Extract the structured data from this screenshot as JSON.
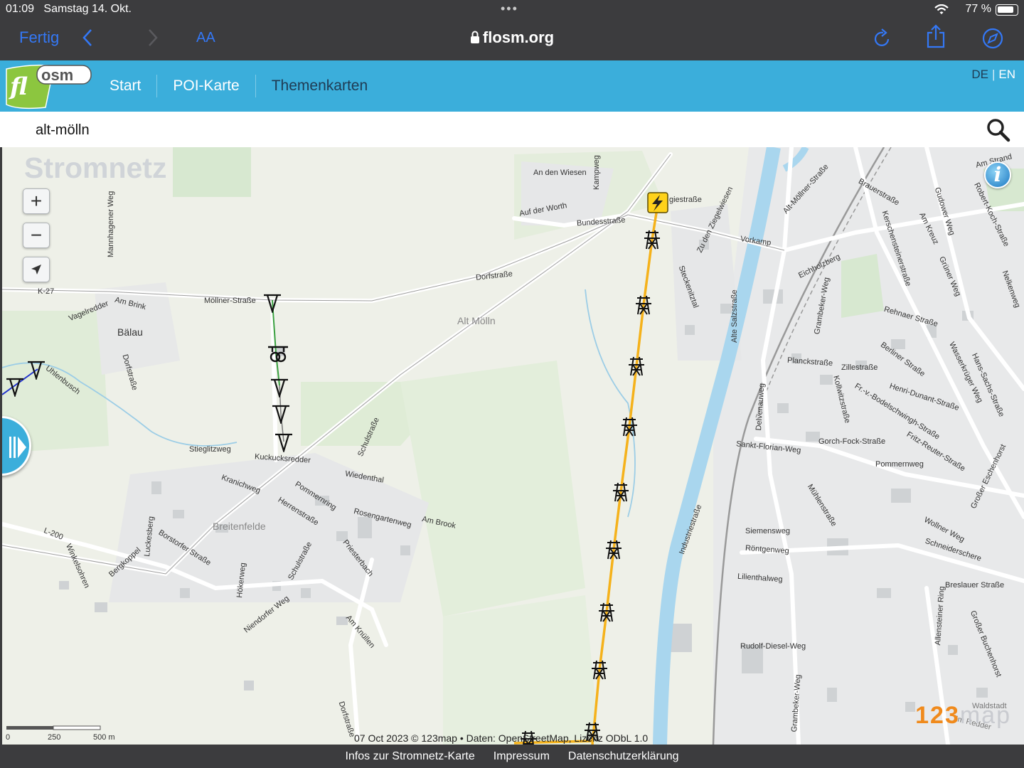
{
  "status_bar": {
    "time": "01:09",
    "date": "Samstag 14. Okt.",
    "battery": "77 %"
  },
  "browser": {
    "done_label": "Fertig",
    "text_size_label": "AA",
    "domain": "flosm.org"
  },
  "site": {
    "logo_text": {
      "part1": "fl",
      "part2": "osm"
    },
    "nav": [
      "Start",
      "POI-Karte",
      "Themenkarten"
    ],
    "lang": {
      "de": "DE",
      "en": "EN"
    }
  },
  "search": {
    "value": "alt-mölln"
  },
  "map": {
    "title": "Stromnetz",
    "controls": {
      "zoom_in": "+",
      "zoom_out": "−"
    },
    "labels": {
      "an_den_wiesen": "An den Wiesen",
      "kampweg": "Kampweg",
      "auf_der_worth": "Auf der Worth",
      "bundesstrasse": "Bundesstraße",
      "giestrasse": "giestraße",
      "zu_den_ziegelwiesen": "Zu den Ziegelwiesen",
      "vorkamp": "Vorkamp",
      "alt_moellner_strasse": "Alt-Möllner-Straße",
      "brauerstrasse": "Brauerstraße",
      "gudower_weg": "Gudower Weg",
      "robert_koch": "Robert-Koch-Straße",
      "am_kreuz": "Am Kreuz",
      "kerschensteiner": "Kerschensteinerstraße",
      "eichholzberg": "Eichholzberg",
      "gruener_weg": "Grüner Weg",
      "nelkenweg": "Nelkenweg",
      "mannhagener_weg": "Mannhagener Weg",
      "dorfstrasse_n": "Dorfstraße",
      "k27": "K-27",
      "moellner_strasse": "Möllner-Straße",
      "am_brink": "Am Brink",
      "vagelredder": "Vagelredder",
      "baelau": "Bälau",
      "dorfstrasse_w": "Dorfstraße",
      "uhlenbusch": "Uhlenbusch",
      "alt_moelln": "Alt Mölln",
      "steckenitztal": "Steckenitztal",
      "alte_salzstrasse": "Alte Salzstraße",
      "grambeker_weg": "Grambeker-Weg",
      "rehnaer_strasse": "Rehnaer Straße",
      "berliner_strasse": "Berliner Straße",
      "hans_sachs": "Hans-Sachs-Straße",
      "planckstrasse": "Planckstraße",
      "zillestrasse": "Zillestraße",
      "wasserkrueger_weg": "Wasserkrüger Weg",
      "henri_dunant": "Henri-Dunant-Straße",
      "bodelschwingh": "Fr.-v.-Bodelschwingh-Straße",
      "kollwitzstrasse": "Kollwitzstraße",
      "delvenauweg": "Delvenauweg",
      "fritz_reuter": "Fritz-Reuter-Straße",
      "sankt_florian": "Sankt-Florian-Weg",
      "gorch_fock": "Gorch-Fock-Straße",
      "pommernweg": "Pommernweg",
      "eschenhorst": "Großer Eschenhorst",
      "stieglitzweg": "Stieglitzweg",
      "kuckucksredder": "Kuckucksredder",
      "schulstrasse_n": "Schulstraße",
      "wiedenthal": "Wiedenthal",
      "kranichweg": "Kranichweg",
      "pommernring": "Pommernring",
      "herrenstrasse": "Herrenstraße",
      "rosengartenweg": "Rosengartenweg",
      "am_brook": "Am Brook",
      "muehlenstrasse": "Mühlenstraße",
      "wollner_weg": "Wollner Weg",
      "industriestrasse": "Industriestraße",
      "breitenfelde": "Breitenfelde",
      "l200": "L-200",
      "luckesberg": "Luckesberg",
      "borstorfer": "Borstorfer Straße",
      "winkelstrasse": "Winkelsohren",
      "bergkoppel": "Bergkoppel",
      "hoekerweg": "Hökerweg",
      "schulstrasse_s": "Schulstraße",
      "niendorfer_weg": "Niendorfer Weg",
      "priesterbach": "Priesterbach",
      "siemensweg": "Siemensweg",
      "roentgenweg": "Röntgenweg",
      "schneiderschere": "Schneiderschere",
      "lilienthalweg": "Lilienthalweg",
      "breslauer": "Breslauer Straße",
      "am_knuellen": "Am Knüllen",
      "allensteiner_ring": "Allensteiner Ring",
      "grosser_buchenhorst": "Großer Buchenhorst",
      "rudolf_diesel": "Rudolf-Diesel-Weg",
      "grambeker_weg_s": "Grambeker-Weg",
      "dorfstrasse_s": "Dorfstraße",
      "waldstadt": "Waldstadt",
      "krebsredder": "Im Redder",
      "am_strand": "Am Strand"
    },
    "scale": {
      "zero": "0",
      "mid": "250",
      "end": "500 m"
    },
    "attribution": "07 Oct 2023 © 123map • Daten: OpenStreetMap, Lizenz ODbL 1.0",
    "brand": {
      "digits": "123",
      "word": "map"
    }
  },
  "footer": [
    "Infos zur Stromnetz-Karte",
    "Impressum",
    "Datenschutzerklärung"
  ],
  "colors": {
    "header_blue": "#3baedb",
    "browser_bg": "#3c3c3e",
    "link_blue": "#3478f6",
    "power_line": "#f5b21b",
    "river": "#a9d6ee"
  },
  "icons": {
    "pylon": "transmission-tower-icon",
    "substation": "lightning-bolt-icon",
    "search": "magnifier-icon"
  }
}
